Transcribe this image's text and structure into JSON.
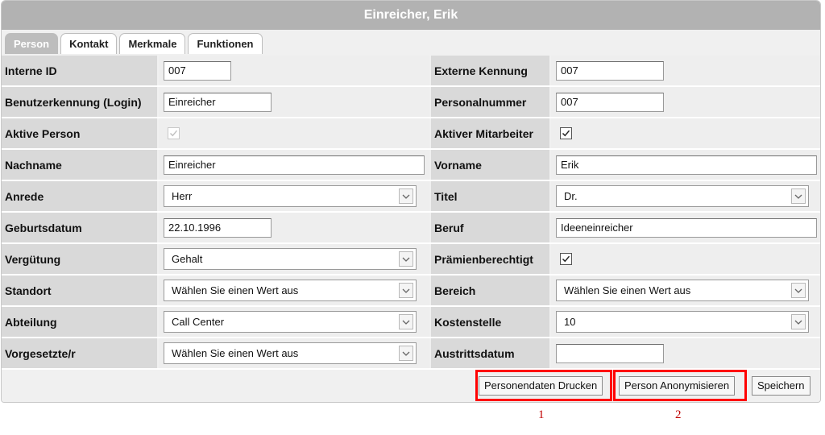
{
  "window": {
    "title": "Einreicher, Erik"
  },
  "tabs": [
    {
      "label": "Person",
      "active": true
    },
    {
      "label": "Kontakt",
      "active": false
    },
    {
      "label": "Merkmale",
      "active": false
    },
    {
      "label": "Funktionen",
      "active": false
    }
  ],
  "form": {
    "interne_id": {
      "label": "Interne ID",
      "value": "007"
    },
    "externe_kennung": {
      "label": "Externe Kennung",
      "value": "007"
    },
    "login": {
      "label": "Benutzerkennung (Login)",
      "value": "Einreicher"
    },
    "personalnummer": {
      "label": "Personalnummer",
      "value": "007"
    },
    "aktive_person": {
      "label": "Aktive Person",
      "checked": true,
      "disabled": true
    },
    "aktiver_mitarbeiter": {
      "label": "Aktiver Mitarbeiter",
      "checked": true
    },
    "nachname": {
      "label": "Nachname",
      "value": "Einreicher"
    },
    "vorname": {
      "label": "Vorname",
      "value": "Erik"
    },
    "anrede": {
      "label": "Anrede",
      "value": "Herr"
    },
    "titel": {
      "label": "Titel",
      "value": "Dr."
    },
    "geburtsdatum": {
      "label": "Geburtsdatum",
      "value": "22.10.1996"
    },
    "beruf": {
      "label": "Beruf",
      "value": "Ideeneinreicher"
    },
    "verguetung": {
      "label": "Vergütung",
      "value": "Gehalt"
    },
    "praemienberechtigt": {
      "label": "Prämienberechtigt",
      "checked": true
    },
    "standort": {
      "label": "Standort",
      "value": "Wählen Sie einen Wert aus"
    },
    "bereich": {
      "label": "Bereich",
      "value": "Wählen Sie einen Wert aus"
    },
    "abteilung": {
      "label": "Abteilung",
      "value": "Call Center"
    },
    "kostenstelle": {
      "label": "Kostenstelle",
      "value": "10"
    },
    "vorgesetzte": {
      "label": "Vorgesetzte/r",
      "value": "Wählen Sie einen Wert aus"
    },
    "austrittsdatum": {
      "label": "Austrittsdatum",
      "value": ""
    }
  },
  "buttons": {
    "print": "Personendaten Drucken",
    "anonymize": "Person Anonymisieren",
    "save": "Speichern"
  },
  "annotations": {
    "marker1": "1",
    "marker2": "2",
    "highlight_color": "#ff0000"
  },
  "icons": {
    "dropdown": "chevron-down-icon",
    "checkmark": "checkmark-icon"
  }
}
